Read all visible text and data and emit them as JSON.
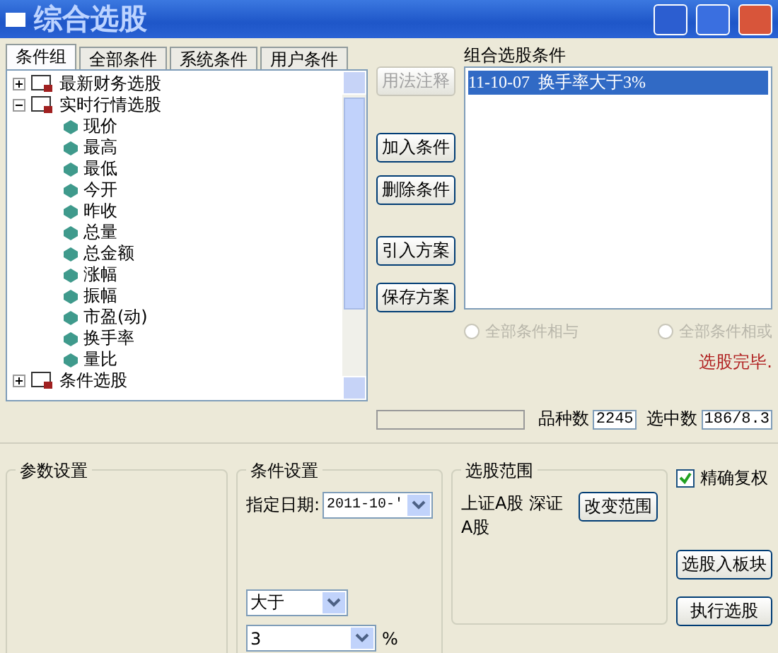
{
  "window": {
    "title": "综合选股"
  },
  "tabs": [
    {
      "label": "条件组",
      "selected": true
    },
    {
      "label": "全部条件",
      "selected": false
    },
    {
      "label": "系统条件",
      "selected": false
    },
    {
      "label": "用户条件",
      "selected": false
    }
  ],
  "tree": [
    {
      "label": "最新财务选股",
      "expanded": false
    },
    {
      "label": "实时行情选股",
      "expanded": true,
      "children": [
        {
          "label": "现价"
        },
        {
          "label": "最高"
        },
        {
          "label": "最低"
        },
        {
          "label": "今开"
        },
        {
          "label": "昨收"
        },
        {
          "label": "总量"
        },
        {
          "label": "总金额"
        },
        {
          "label": "涨幅"
        },
        {
          "label": "振幅"
        },
        {
          "label": "市盈(动)"
        },
        {
          "label": "换手率"
        },
        {
          "label": "量比"
        }
      ]
    },
    {
      "label": "条件选股",
      "expanded": false
    }
  ],
  "action_buttons": [
    {
      "label": "用法注释",
      "disabled": true
    },
    {
      "label": "加入条件",
      "disabled": false
    },
    {
      "label": "删除条件",
      "disabled": false
    },
    {
      "label": "引入方案",
      "disabled": false
    },
    {
      "label": "保存方案",
      "disabled": false
    }
  ],
  "conditions": {
    "title": "组合选股条件",
    "items": [
      {
        "label": "11-10-07  换手率大于3%",
        "selected": true
      }
    ]
  },
  "logic": [
    {
      "label": "全部条件相与",
      "selected": false,
      "disabled": true
    },
    {
      "label": "全部条件相或",
      "selected": false,
      "disabled": true
    }
  ],
  "status_message": "选股完毕.",
  "status_bar": {
    "total_label": "品种数",
    "total": "2245",
    "picked_label": "选中数",
    "picked": "186/8.3"
  },
  "params": {
    "title": "参数设置"
  },
  "condition_settings": {
    "title": "条件设置",
    "date_label": "指定日期:",
    "date": "2011-10-'",
    "operator": "大于",
    "value": "3",
    "unit": "%"
  },
  "scope": {
    "title": "选股范围",
    "text": "上证A股 深证A股",
    "change_button": "改变范围"
  },
  "exact_rights": {
    "label": "精确复权",
    "checked": true
  },
  "side_buttons": [
    "选股入板块",
    "执行选股"
  ]
}
